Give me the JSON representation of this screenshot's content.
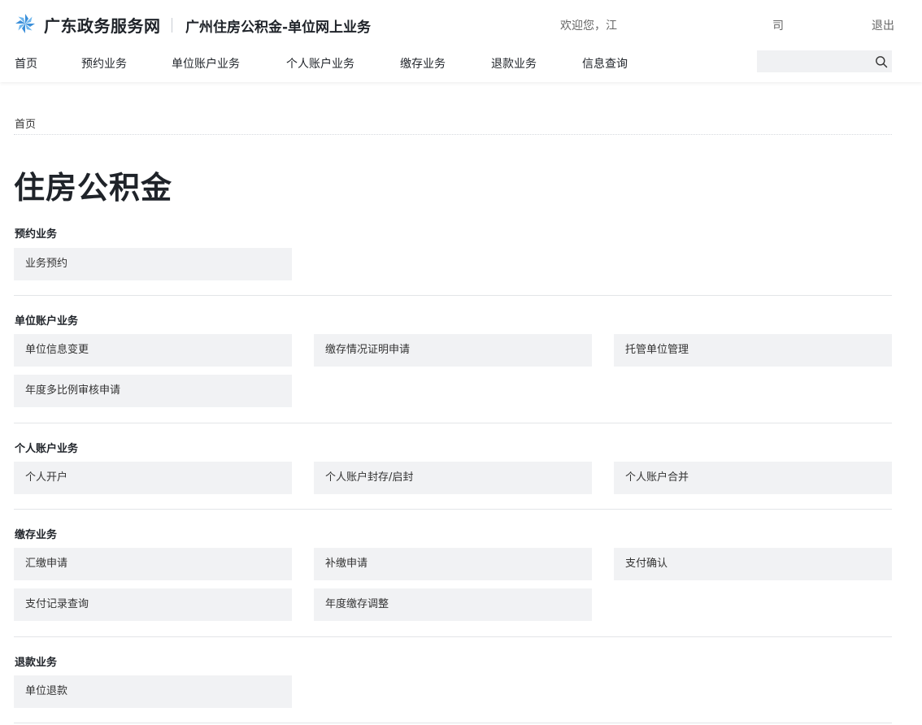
{
  "header": {
    "brand": "广东政务服务网",
    "site_title": "广州住房公积金-单位网上业务",
    "welcome": "欢迎您，江",
    "company": "司",
    "logout": "退出"
  },
  "nav": {
    "items": [
      "首页",
      "预约业务",
      "单位账户业务",
      "个人账户业务",
      "缴存业务",
      "退款业务",
      "信息查询"
    ]
  },
  "search": {
    "placeholder": ""
  },
  "breadcrumb": "首页",
  "page_title": "住房公积金",
  "sections": [
    {
      "title": "预约业务",
      "items": [
        "业务预约"
      ]
    },
    {
      "title": "单位账户业务",
      "items": [
        "单位信息变更",
        "缴存情况证明申请",
        "托管单位管理",
        "年度多比例审核申请"
      ]
    },
    {
      "title": "个人账户业务",
      "items": [
        "个人开户",
        "个人账户封存/启封",
        "个人账户合并"
      ]
    },
    {
      "title": "缴存业务",
      "items": [
        "汇缴申请",
        "补缴申请",
        "支付确认",
        "支付记录查询",
        "年度缴存调整"
      ]
    },
    {
      "title": "退款业务",
      "items": [
        "单位退款"
      ]
    }
  ],
  "colors": {
    "brand_blue": "#3b82d6",
    "card_bg": "#f1f2f4"
  }
}
